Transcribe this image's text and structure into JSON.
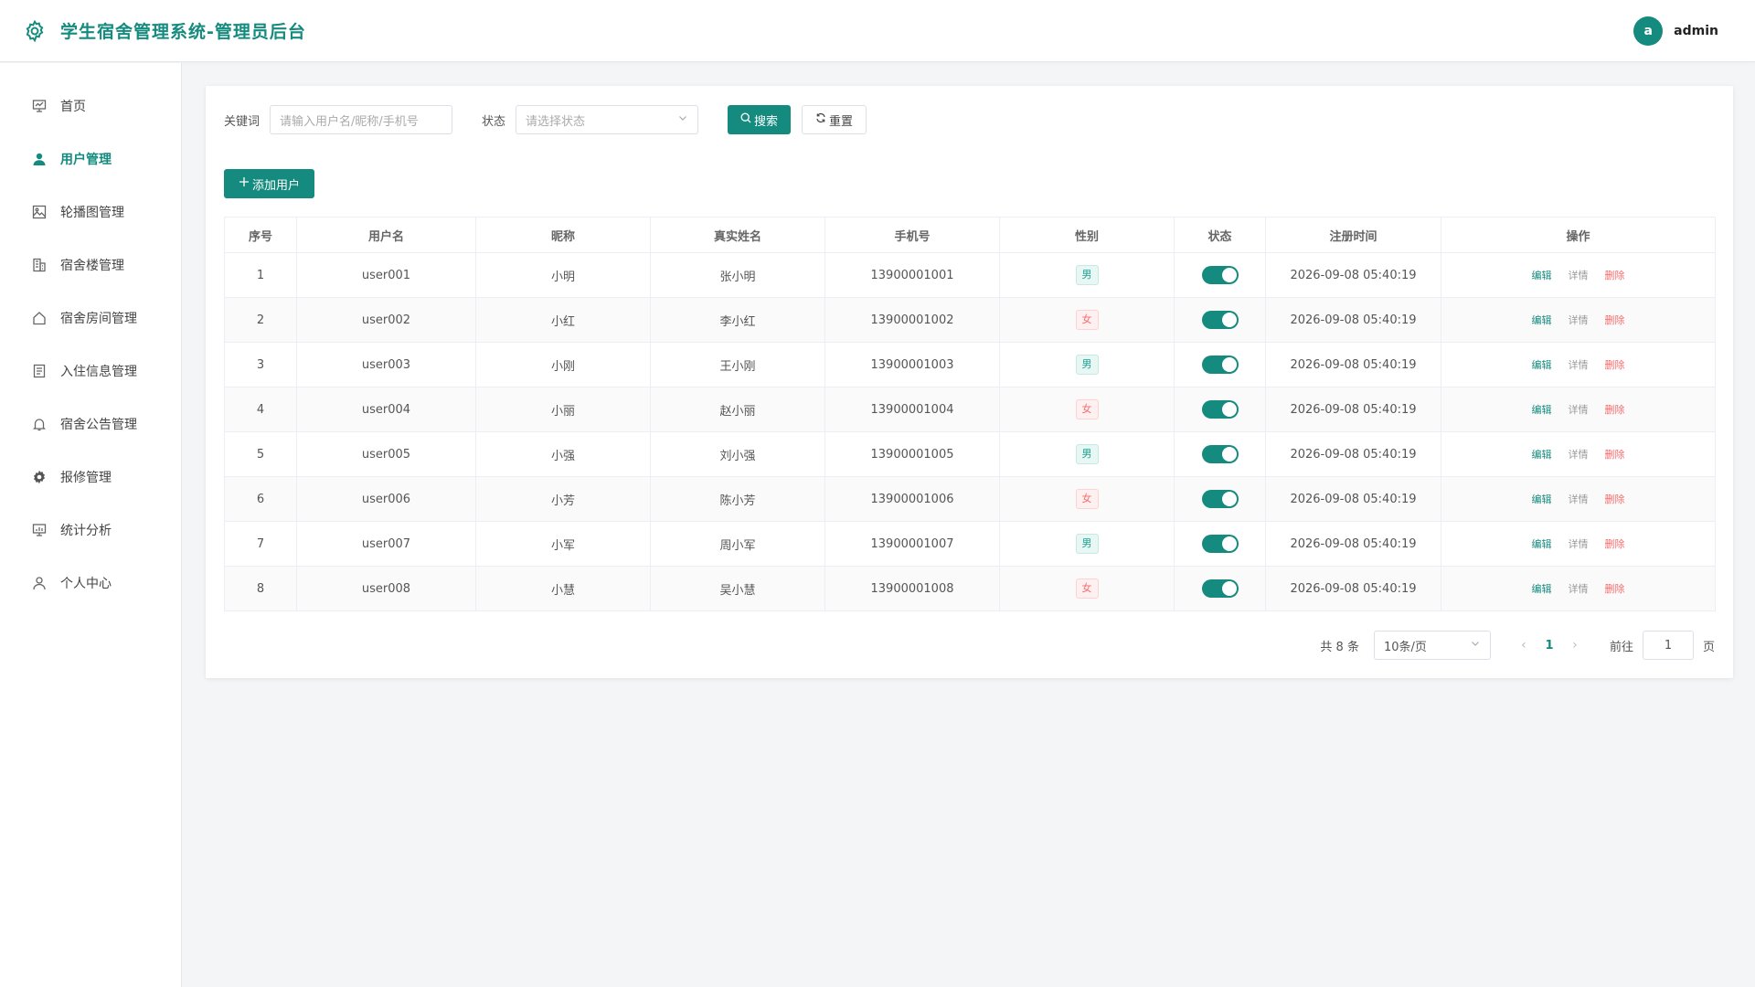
{
  "header": {
    "title": "学生宿舍管理系统-管理员后台",
    "avatar_letter": "a",
    "username": "admin"
  },
  "sidebar": {
    "items": [
      {
        "label": "首页",
        "icon": "dashboard-icon"
      },
      {
        "label": "用户管理",
        "icon": "user-icon",
        "active": true
      },
      {
        "label": "轮播图管理",
        "icon": "image-icon"
      },
      {
        "label": "宿舍楼管理",
        "icon": "building-icon"
      },
      {
        "label": "宿舍房间管理",
        "icon": "house-icon"
      },
      {
        "label": "入住信息管理",
        "icon": "document-icon"
      },
      {
        "label": "宿舍公告管理",
        "icon": "bell-icon"
      },
      {
        "label": "报修管理",
        "icon": "gear-icon"
      },
      {
        "label": "统计分析",
        "icon": "chart-icon"
      },
      {
        "label": "个人中心",
        "icon": "person-icon"
      }
    ]
  },
  "filters": {
    "keyword_label": "关键词",
    "keyword_placeholder": "请输入用户名/昵称/手机号",
    "status_label": "状态",
    "status_placeholder": "请选择状态",
    "search_label": "搜索",
    "reset_label": "重置"
  },
  "add_button": "添加用户",
  "table": {
    "columns": [
      "序号",
      "用户名",
      "昵称",
      "真实姓名",
      "手机号",
      "性别",
      "状态",
      "注册时间",
      "操作"
    ],
    "rows": [
      {
        "no": "1",
        "username": "user001",
        "nickname": "小明",
        "realname": "张小明",
        "phone": "13900001001",
        "gender": "男",
        "enabled": true,
        "registered": "2026-09-08 05:40:19"
      },
      {
        "no": "2",
        "username": "user002",
        "nickname": "小红",
        "realname": "李小红",
        "phone": "13900001002",
        "gender": "女",
        "enabled": true,
        "registered": "2026-09-08 05:40:19"
      },
      {
        "no": "3",
        "username": "user003",
        "nickname": "小刚",
        "realname": "王小刚",
        "phone": "13900001003",
        "gender": "男",
        "enabled": true,
        "registered": "2026-09-08 05:40:19"
      },
      {
        "no": "4",
        "username": "user004",
        "nickname": "小丽",
        "realname": "赵小丽",
        "phone": "13900001004",
        "gender": "女",
        "enabled": true,
        "registered": "2026-09-08 05:40:19"
      },
      {
        "no": "5",
        "username": "user005",
        "nickname": "小强",
        "realname": "刘小强",
        "phone": "13900001005",
        "gender": "男",
        "enabled": true,
        "registered": "2026-09-08 05:40:19"
      },
      {
        "no": "6",
        "username": "user006",
        "nickname": "小芳",
        "realname": "陈小芳",
        "phone": "13900001006",
        "gender": "女",
        "enabled": true,
        "registered": "2026-09-08 05:40:19"
      },
      {
        "no": "7",
        "username": "user007",
        "nickname": "小军",
        "realname": "周小军",
        "phone": "13900001007",
        "gender": "男",
        "enabled": true,
        "registered": "2026-09-08 05:40:19"
      },
      {
        "no": "8",
        "username": "user008",
        "nickname": "小慧",
        "realname": "吴小慧",
        "phone": "13900001008",
        "gender": "女",
        "enabled": true,
        "registered": "2026-09-08 05:40:19"
      }
    ],
    "actions": {
      "edit": "编辑",
      "detail": "详情",
      "delete": "删除"
    }
  },
  "pagination": {
    "total_text": "共 8 条",
    "page_size": "10条/页",
    "current_page": "1",
    "goto_label": "前往",
    "goto_value": "1",
    "page_suffix": "页"
  },
  "colors": {
    "primary": "#158a7e",
    "danger": "#f56c6c"
  }
}
